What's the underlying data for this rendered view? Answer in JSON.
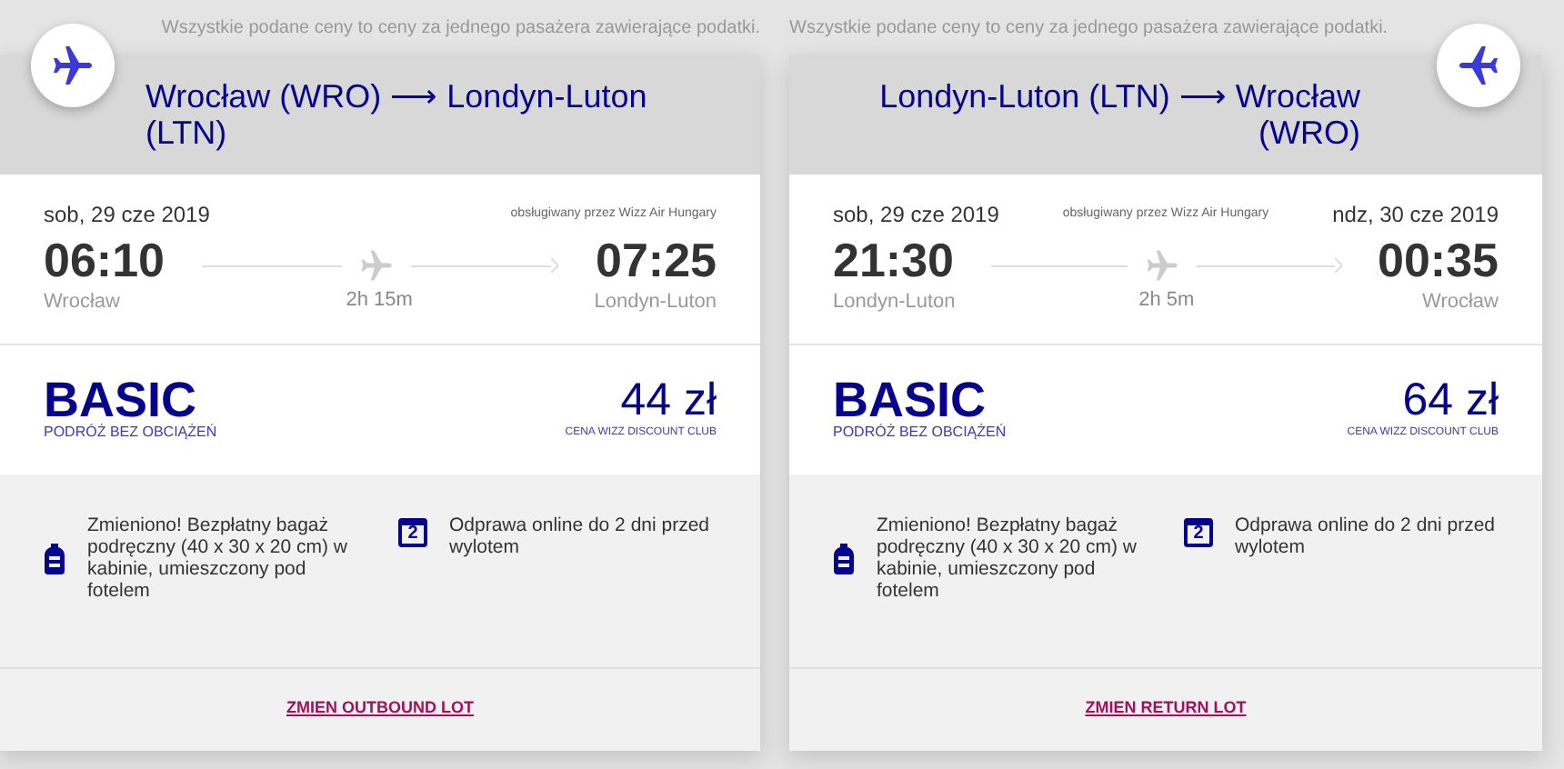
{
  "cards": [
    {
      "notice": "Wszystkie podane ceny to ceny za jednego pasażera zawierające podatki.",
      "kind": "outbound",
      "route": "Wrocław (WRO) ⟶ Londyn-Luton (LTN)",
      "departure_date": "sob, 29 cze 2019",
      "operated_by": "obsługiwany przez Wizz Air Hungary",
      "departure_time": "06:10",
      "duration": "2h 15m",
      "arrival_time": "07:25",
      "departure_city": "Wrocław",
      "arrival_city": "Londyn-Luton",
      "fare": "BASIC",
      "fare_subtitle": "PODRÓŻ BEZ OBCIĄŻEŃ",
      "price": "44 zł",
      "price_note": "CENA WIZZ DISCOUNT CLUB",
      "features": [
        {
          "kind": "bag",
          "text": "Zmieniono! Bezpłatny bagaż podręczny (40 x 30 x 20 cm) w kabinie, umieszczony pod fotelem"
        },
        {
          "kind": "calendar",
          "icon_text": "2",
          "text": "Odprawa online do 2 dni przed wylotem"
        }
      ],
      "link": "ZMIEN OUTBOUND LOT"
    },
    {
      "notice": "Wszystkie podane ceny to ceny za jednego pasażera zawierające podatki.",
      "kind": "return",
      "route": "Londyn-Luton (LTN) ⟶ Wrocław (WRO)",
      "departure_date": "sob, 29 cze 2019",
      "operated_by": "obsługiwany przez Wizz Air Hungary",
      "arrival_date": "ndz, 30 cze 2019",
      "departure_time": "21:30",
      "duration": "2h 5m",
      "arrival_time": "00:35",
      "departure_city": "Londyn-Luton",
      "arrival_city": "Wrocław",
      "fare": "BASIC",
      "fare_subtitle": "PODRÓŻ BEZ OBCIĄŻEŃ",
      "price": "64 zł",
      "price_note": "CENA WIZZ DISCOUNT CLUB",
      "features": [
        {
          "kind": "bag",
          "text": "Zmieniono! Bezpłatny bagaż podręczny (40 x 30 x 20 cm) w kabinie, umieszczony pod fotelem"
        },
        {
          "kind": "calendar",
          "icon_text": "2",
          "text": "Odprawa online do 2 dni przed wylotem"
        }
      ],
      "link": "ZMIEN RETURN LOT"
    }
  ]
}
